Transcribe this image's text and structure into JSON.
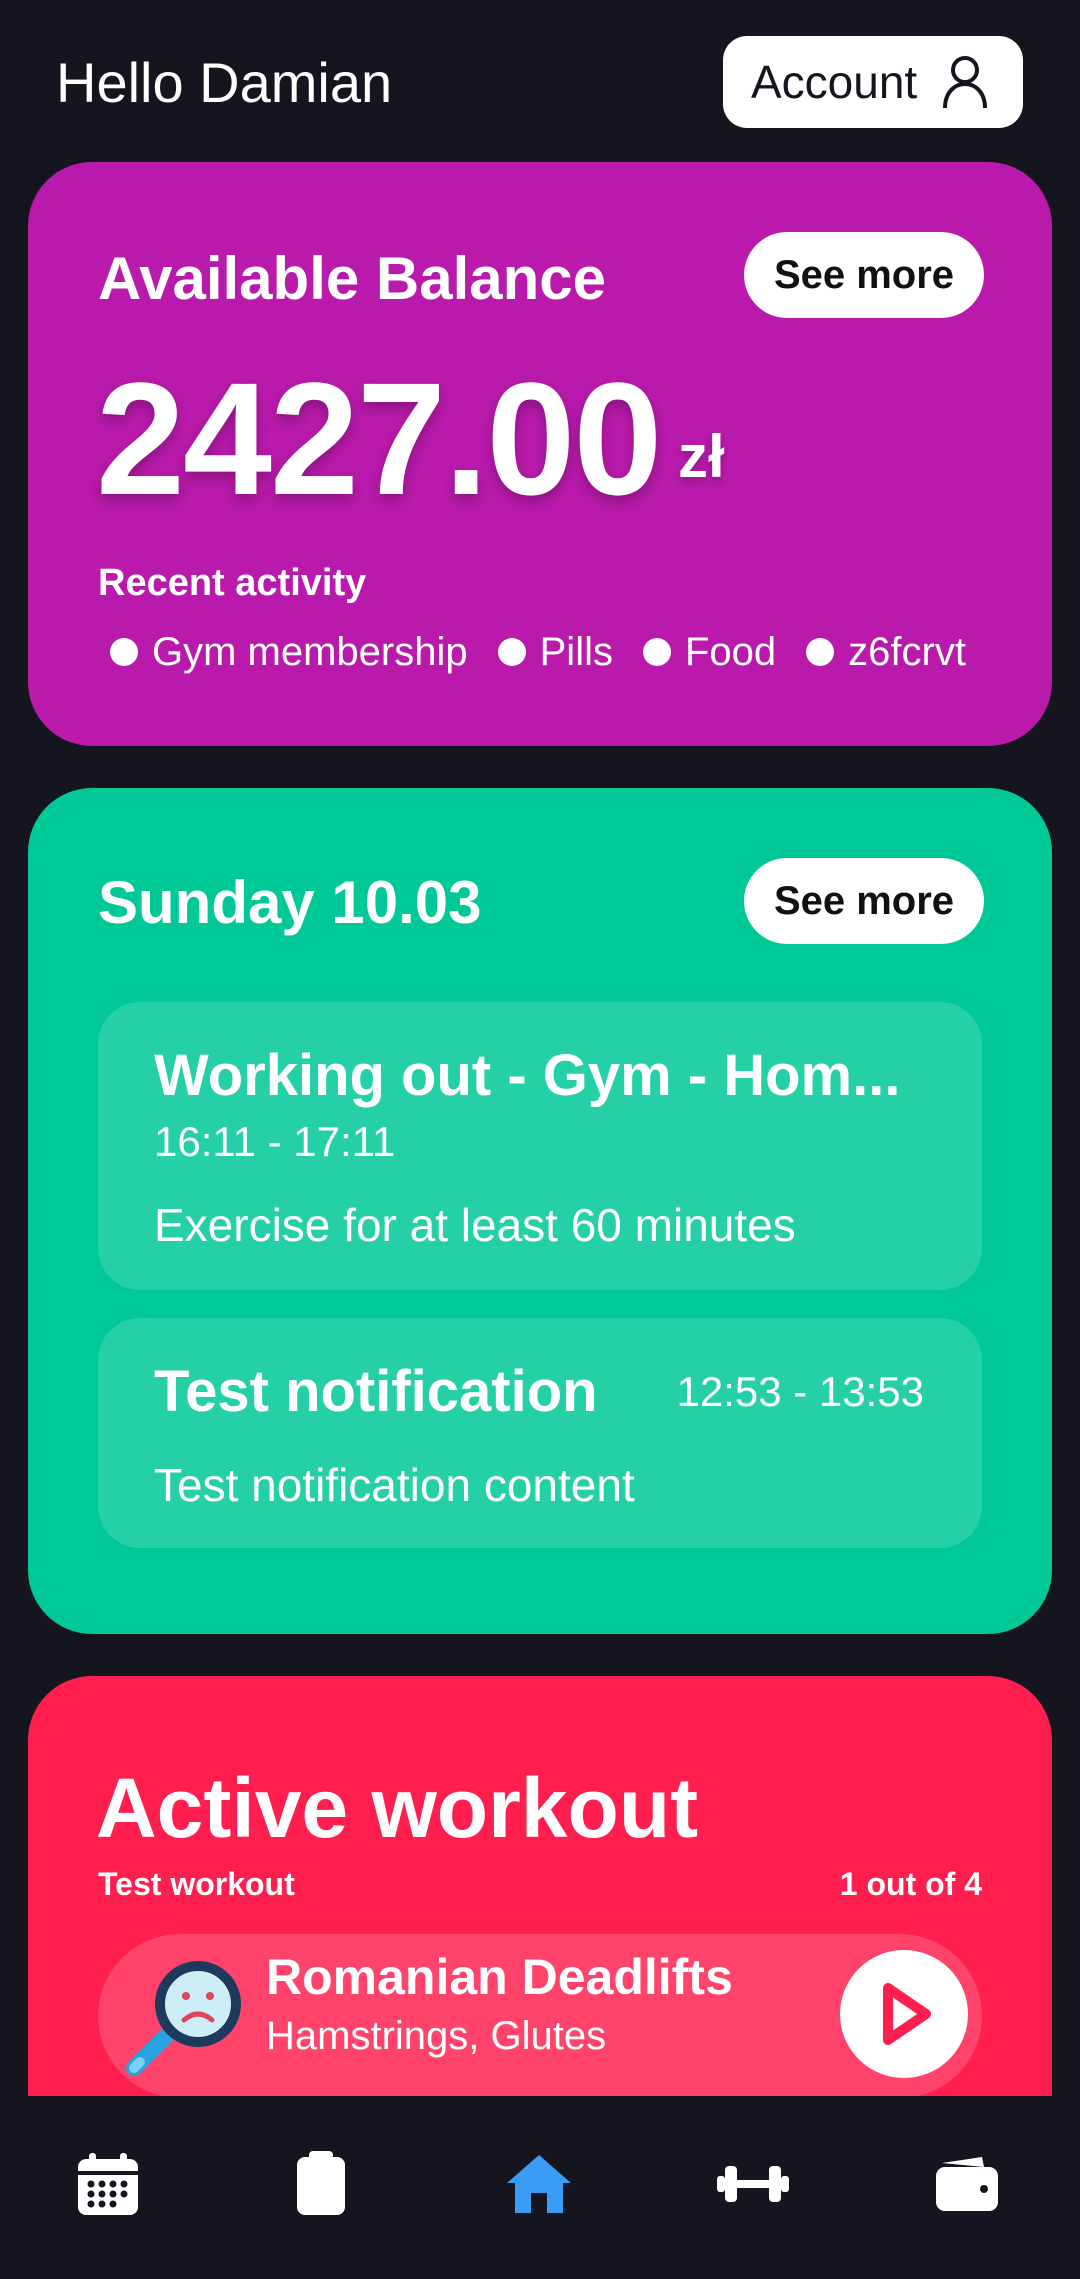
{
  "header": {
    "greeting": "Hello Damian",
    "account_label": "Account",
    "account_icon": "user-icon"
  },
  "balance_card": {
    "title": "Available Balance",
    "see_more": "See more",
    "amount": "2427.00",
    "currency": "zł",
    "recent_label": "Recent activity",
    "activities": [
      "Gym membership",
      "Pills",
      "Food",
      "z6fcrvt"
    ],
    "color": "#b91aab"
  },
  "schedule_card": {
    "title": "Sunday 10.03",
    "see_more": "See more",
    "color": "#00c897",
    "events": [
      {
        "title": "Working out - Gym - Hom...",
        "time": "16:11 - 17:11",
        "description": "Exercise for at least 60 minutes"
      },
      {
        "title": "Test notification",
        "time": "12:53 - 13:53",
        "description": "Test notification content"
      }
    ]
  },
  "workout_card": {
    "title": "Active workout",
    "workout_name": "Test workout",
    "progress": "1 out of 4",
    "color": "#ff1f4f",
    "exercise": {
      "name": "Romanian Deadlifts",
      "muscles": "Hamstrings, Glutes",
      "icon": "sad-magnifier-icon"
    }
  },
  "bottom_nav": {
    "items": [
      {
        "icon": "calendar-icon",
        "active": false
      },
      {
        "icon": "clipboard-icon",
        "active": false
      },
      {
        "icon": "home-icon",
        "active": true
      },
      {
        "icon": "dumbbell-icon",
        "active": false
      },
      {
        "icon": "wallet-icon",
        "active": false
      }
    ],
    "active_color": "#3b9cf5"
  }
}
